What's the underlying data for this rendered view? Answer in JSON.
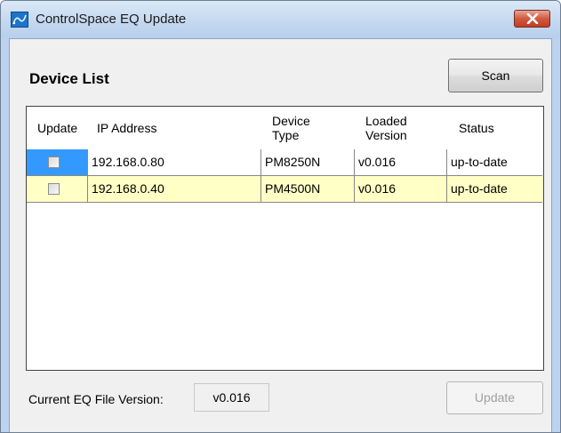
{
  "window": {
    "title": "ControlSpace EQ Update"
  },
  "device_list": {
    "heading": "Device List",
    "scan_label": "Scan"
  },
  "columns": {
    "update": "Update",
    "ip": "IP Address",
    "type_line1": "Device",
    "type_line2": "Type",
    "version_line1": "Loaded",
    "version_line2": "Version",
    "status": "Status"
  },
  "rows": [
    {
      "checked": false,
      "ip": "192.168.0.80",
      "type": "PM8250N",
      "version": "v0.016",
      "status": "up-to-date"
    },
    {
      "checked": false,
      "ip": "192.168.0.40",
      "type": "PM4500N",
      "version": "v0.016",
      "status": "up-to-date"
    }
  ],
  "footer": {
    "version_label": "Current EQ File Version:",
    "version_value": "v0.016",
    "update_label": "Update"
  },
  "colors": {
    "selected_row_bg": "#ffffc6",
    "selected_cell_bg": "#3399ff",
    "titlebar": "#c3d7ef",
    "close_red": "#c23d22"
  },
  "icons": [
    "app-icon",
    "close-icon"
  ]
}
